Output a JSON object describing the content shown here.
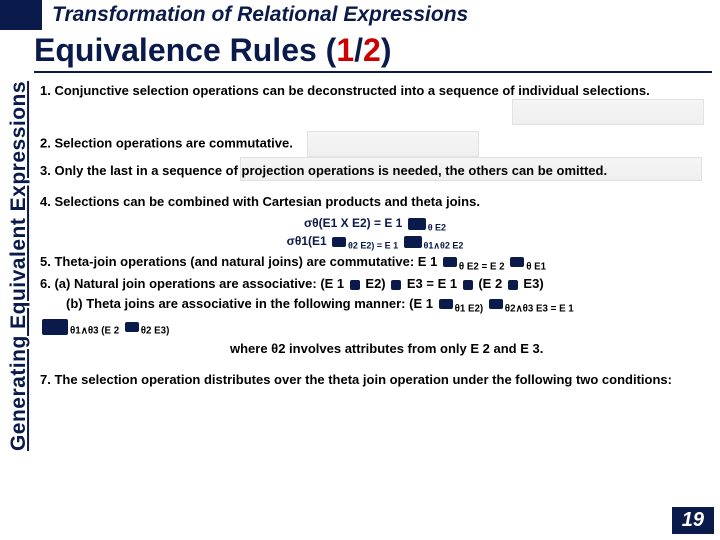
{
  "header": "Transformation of Relational Expressions",
  "title": {
    "prefix": "Equivalence Rules (",
    "current": "1",
    "sep": "/",
    "total": "2",
    "suffix": ")"
  },
  "sidebar": "Generating Equivalent Expressions",
  "items": {
    "r1": "1. Conjunctive selection operations can be deconstructed into a sequence of individual selections.",
    "r2": "2. Selection operations are commutative.",
    "r3": "3. Only the last in a sequence of projection operations is needed, the others can be omitted.",
    "r4": "4. Selections can be combined with Cartesian products and theta joins.",
    "r4f1_left": "σθ(E1 X E2) =  E 1",
    "r4f1_right": "θ E2",
    "r4f2_left": "σθ1(E1",
    "r4f2_mid": "θ2 E2) =  E 1",
    "r4f2_right": "θ1∧θ2 E2",
    "r5_a": "5. Theta-join operations (and natural joins) are commutative: E 1",
    "r5_b": "θ E2 = E 2",
    "r5_c": "θ E1",
    "r6a_a": "6. (a) Natural join operations are associative:      (E 1",
    "r6a_b": " E2)",
    "r6a_c": " E3 = E 1",
    "r6a_d": " (E 2",
    "r6a_e": " E3)",
    "r6b_a": "(b) Theta joins are associative in the following manner: (E 1",
    "r6b_b": "θ1 E2)",
    "r6b_c": "θ2∧θ3 E3 = E 1",
    "r6b2_a": "θ1∧θ3 (E 2",
    "r6b2_b": "θ2 E3)",
    "note": "where θ2 involves attributes from only E 2 and E 3.",
    "r7": "7. The selection operation distributes over the theta join operation under the following two conditions:"
  },
  "page_number": "19"
}
